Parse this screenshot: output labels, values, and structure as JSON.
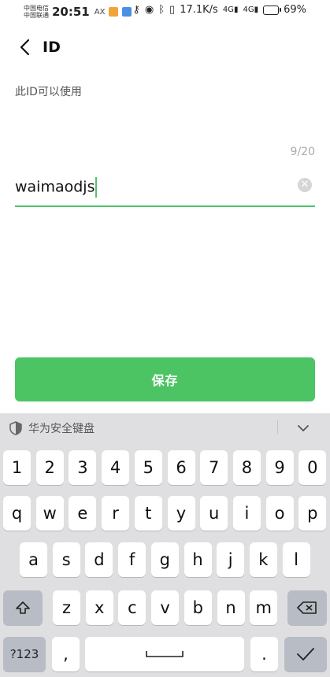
{
  "status_bar": {
    "carrier1": "中国电信",
    "carrier2": "中国联通",
    "time": "20:51",
    "ax": "AX",
    "network_speed": "17.1K/s",
    "battery": "69%",
    "signal1": "4G",
    "signal2": "4G"
  },
  "header": {
    "title": "ID"
  },
  "form": {
    "hint": "此ID可以使用",
    "counter": "9/20",
    "value": "waimaodjs",
    "save_label": "保存"
  },
  "keyboard": {
    "name": "华为安全键盘",
    "row_digits": [
      "1",
      "2",
      "3",
      "4",
      "5",
      "6",
      "7",
      "8",
      "9",
      "0"
    ],
    "row1": [
      "q",
      "w",
      "e",
      "r",
      "t",
      "y",
      "u",
      "i",
      "o",
      "p"
    ],
    "row2": [
      "a",
      "s",
      "d",
      "f",
      "g",
      "h",
      "j",
      "k",
      "l"
    ],
    "row3": [
      "z",
      "x",
      "c",
      "v",
      "b",
      "n",
      "m"
    ],
    "numbers_label": "?123",
    "comma": ",",
    "period": "."
  },
  "colors": {
    "accent": "#4cc464",
    "keyboard_bg": "#dfdfe1"
  }
}
